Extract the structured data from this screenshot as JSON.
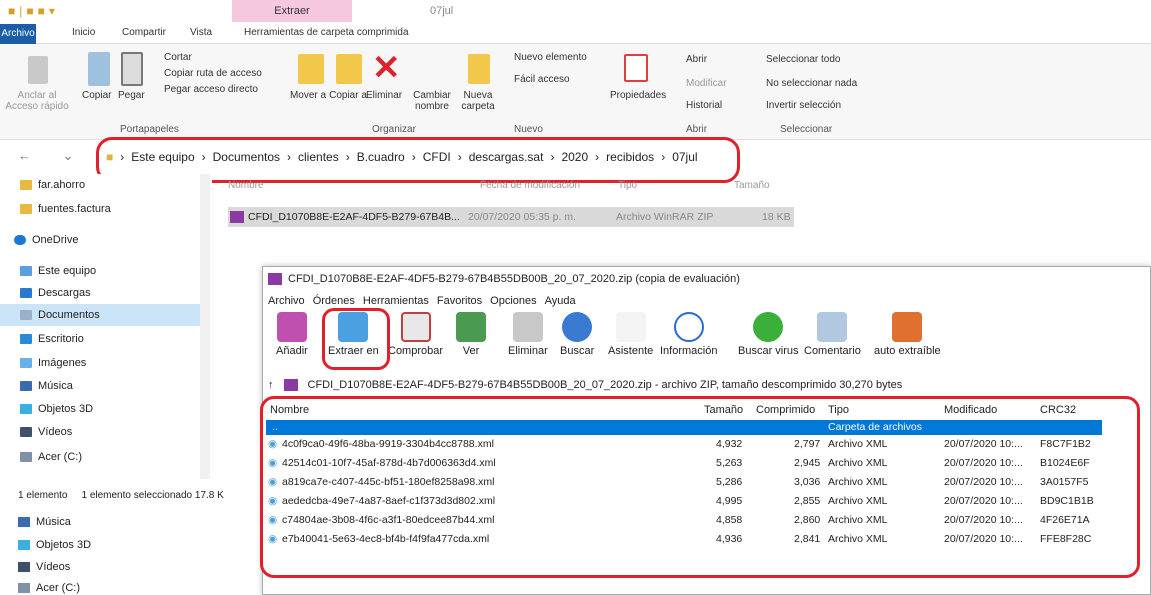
{
  "window": {
    "context_tab": "Extraer",
    "folder_title": "07jul"
  },
  "tabs": [
    "Archivo",
    "Inicio",
    "Compartir",
    "Vista",
    "Herramientas de carpeta comprimida"
  ],
  "ribbon": {
    "anclar": "Anclar al Acceso rápido",
    "copiar": "Copiar",
    "pegar": "Pegar",
    "cortar": "Cortar",
    "copiar_ruta": "Copiar ruta de acceso",
    "pegar_acceso": "Pegar acceso directo",
    "mover": "Mover a",
    "copiar_a": "Copiar a",
    "eliminar": "Eliminar",
    "cambiar": "Cambiar nombre",
    "nueva": "Nueva carpeta",
    "nuevo_elemento": "Nuevo elemento",
    "facil_acceso": "Fácil acceso",
    "propiedades": "Propiedades",
    "abrir": "Abrir",
    "modificar": "Modificar",
    "historial": "Historial",
    "sel_todo": "Seleccionar todo",
    "no_sel": "No seleccionar nada",
    "invertir": "Invertir selección",
    "groups": [
      "Portapapeles",
      "Organizar",
      "Nuevo",
      "Abrir",
      "Seleccionar"
    ]
  },
  "address": [
    "Este equipo",
    "Documentos",
    "clientes",
    "B.cuadro",
    "CFDI",
    "descargas.sat",
    "2020",
    "recibidos",
    "07jul"
  ],
  "sidebar": [
    "far.ahorro",
    "fuentes.factura",
    "OneDrive",
    "Este equipo",
    "Descargas",
    "Documentos",
    "Escritorio",
    "Imágenes",
    "Música",
    "Objetos 3D",
    "Vídeos",
    "Acer (C:)"
  ],
  "sidebar2": [
    "Música",
    "Objetos 3D",
    "Vídeos",
    "Acer (C:)"
  ],
  "status": {
    "count": "1 elemento",
    "selected": "1 elemento seleccionado  17.8 K"
  },
  "explorer_headers": [
    "Nombre",
    "Fecha de modificación",
    "Tipo",
    "Tamaño"
  ],
  "zip_file": {
    "name": "CFDI_D1070B8E-E2AF-4DF5-B279-67B4B...",
    "date": "20/07/2020 05:35 p. m.",
    "type": "Archivo WinRAR ZIP",
    "size": "18 KB"
  },
  "rar": {
    "title": "CFDI_D1070B8E-E2AF-4DF5-B279-67B4B55DB00B_20_07_2020.zip (copia de evaluación)",
    "menu": [
      "Archivo",
      "Órdenes",
      "Herramientas",
      "Favoritos",
      "Opciones",
      "Ayuda"
    ],
    "tools": [
      "Añadir",
      "Extraer en",
      "Comprobar",
      "Ver",
      "Eliminar",
      "Buscar",
      "Asistente",
      "Información",
      "Buscar virus",
      "Comentario",
      "auto extraíble"
    ],
    "path": "CFDI_D1070B8E-E2AF-4DF5-B279-67B4B55DB00B_20_07_2020.zip - archivo ZIP, tamaño descomprimido 30,270 bytes",
    "headers": [
      "Nombre",
      "Tamaño",
      "Comprimido",
      "Tipo",
      "Modificado",
      "CRC32"
    ],
    "parent": {
      "name": "..",
      "type": "Carpeta de archivos"
    },
    "files": [
      [
        "4c0f9ca0-49f6-48ba-9919-3304b4cc8788.xml",
        "4,932",
        "2,797",
        "Archivo XML",
        "20/07/2020 10:...",
        "F8C7F1B2"
      ],
      [
        "42514c01-10f7-45af-878d-4b7d006363d4.xml",
        "5,263",
        "2,945",
        "Archivo XML",
        "20/07/2020 10:...",
        "B1024E6F"
      ],
      [
        "a819ca7e-c407-445c-bf51-180ef8258a98.xml",
        "5,286",
        "3,036",
        "Archivo XML",
        "20/07/2020 10:...",
        "3A0157F5"
      ],
      [
        "aededcba-49e7-4a87-8aef-c1f373d3d802.xml",
        "4,995",
        "2,855",
        "Archivo XML",
        "20/07/2020 10:...",
        "BD9C1B1B"
      ],
      [
        "c74804ae-3b08-4f6c-a3f1-80edcee87b44.xml",
        "4,858",
        "2,860",
        "Archivo XML",
        "20/07/2020 10:...",
        "4F26E71A"
      ],
      [
        "e7b40041-5e63-4ec8-bf4b-f4f9fa477cda.xml",
        "4,936",
        "2,841",
        "Archivo XML",
        "20/07/2020 10:...",
        "FFE8F28C"
      ]
    ]
  }
}
